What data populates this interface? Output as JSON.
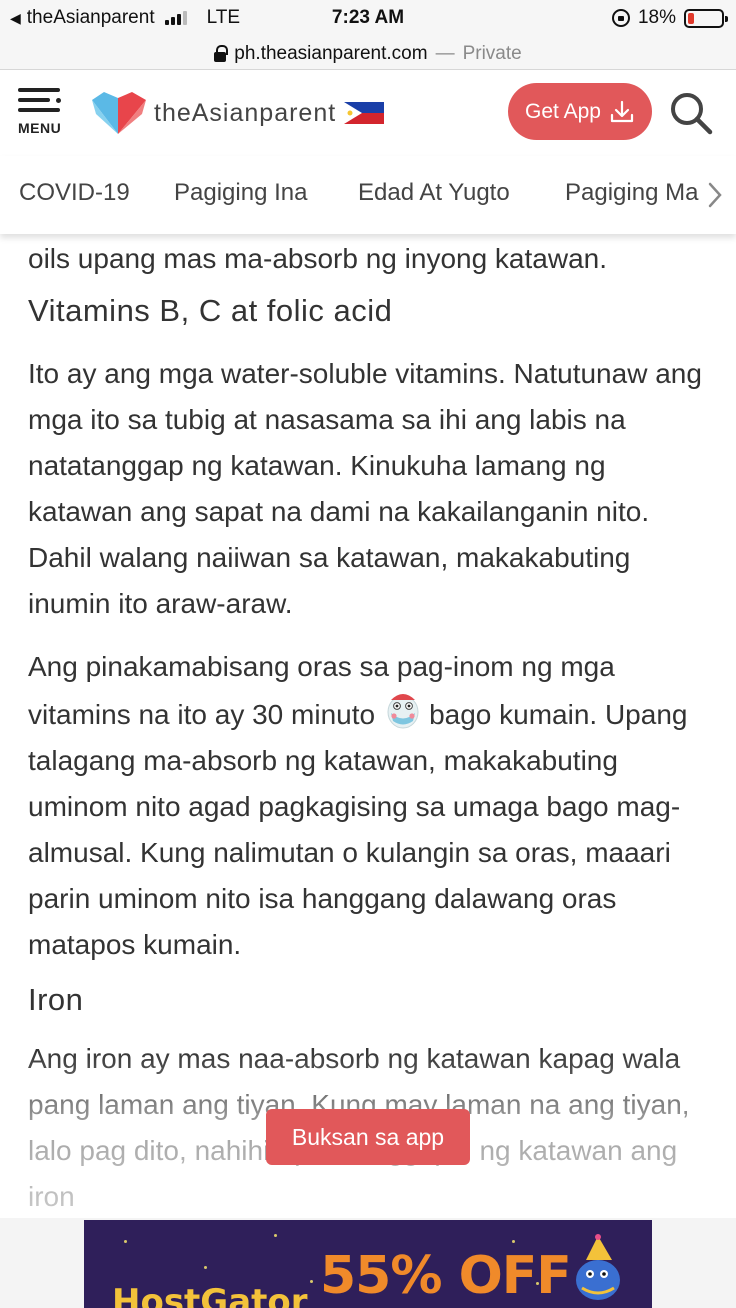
{
  "status_bar": {
    "back_app": "theAsianparent",
    "carrier": "LTE",
    "time": "7:23 AM",
    "battery": "18%",
    "battery_level": 0.18
  },
  "url_bar": {
    "domain": "ph.theasianparent.com",
    "separator": "—",
    "mode": "Private"
  },
  "header": {
    "menu_label": "MENU",
    "brand": "theAsianparent",
    "get_app_label": "Get App",
    "icons": [
      "menu-icon",
      "heart-logo-icon",
      "philippine-flag-icon",
      "download-icon",
      "search-icon"
    ]
  },
  "nav": {
    "items": [
      "COVID-19",
      "Pagiging Ina",
      "Edad At Yugto",
      "Pagiging Ma"
    ]
  },
  "article": {
    "intro_tail": "oils upang mas ma-absorb ng inyong katawan.",
    "section1": {
      "heading": "Vitamins B, C at folic acid",
      "para1": "Ito ay ang mga water-soluble vitamins. Natutunaw ang mga ito sa tubig at nasasama sa ihi ang labis na natatanggap ng katawan. Kinukuha lamang ng katawan ang sapat na dami na kakailanganin nito. Dahil walang naiiwan sa katawan, makakabuting inumin ito araw-araw.",
      "para2_a": "Ang pinakamabisang oras sa pag-inom ng mga vitamins na ito ay 30 minuto",
      "para2_b": "bago kumain. Upang talagang ma-absorb ng katawan, makakabuting uminom nito agad pagkagising sa umaga bago mag-almusal. Kung nalimutan o kulangin sa oras, maaari parin uminom nito isa hanggang dalawang oras matapos kumain."
    },
    "section2": {
      "heading": "Iron",
      "para1": "Ang iron ay mas naa-absorb ng katawan kapag wala pang laman ang tiyan. Kung may laman na ang tiyan, lalo pag dito, nahihirapan tanggapin ng katawan ang iron"
    }
  },
  "open_app_label": "Buksan sa app",
  "ad": {
    "brand": "HostGator",
    "offer": "55% OFF",
    "colors": {
      "background": "#2f1f5a",
      "offer": "#f08a2a",
      "brand": "#f3c23a"
    }
  },
  "colors": {
    "accent": "#e1585a",
    "text": "#333333"
  }
}
